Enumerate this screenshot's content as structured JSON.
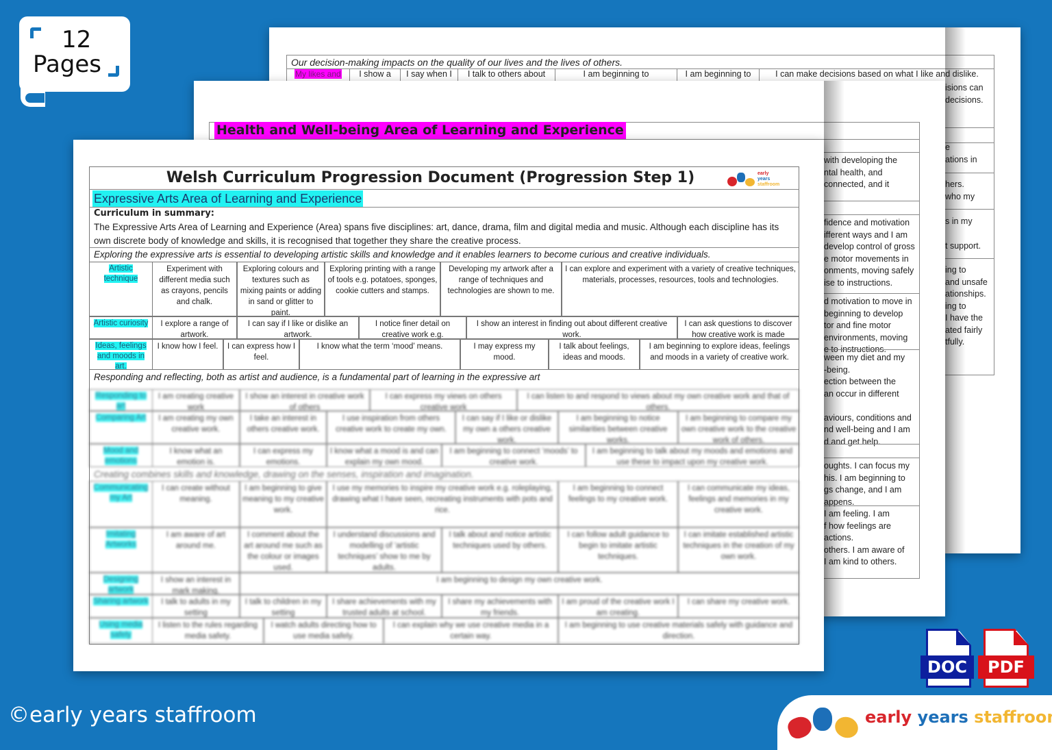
{
  "badge": {
    "count": "12",
    "label": "Pages",
    "icon": "page-scroll-icon"
  },
  "back_page": {
    "heading": "Our decision-making impacts on the quality of our lives and the lives of others.",
    "row_label": "My likes and",
    "row_cells": [
      "I show a",
      "I say when I",
      "I talk to others about",
      "I am beginning to",
      "I am beginning to",
      "I can make decisions based on what I like and dislike."
    ],
    "right_fragments": [
      "isions can",
      "decisions.",
      "e",
      "ations in",
      "hers.",
      "who my",
      "s in my",
      "t support.",
      "ing to",
      "and unsafe",
      "ationships.",
      "ing to",
      "I have the",
      "ated fairly",
      "tfully."
    ]
  },
  "middle_page": {
    "title": "Health and Well-being Area of Learning and Experience",
    "right_cells": [
      [
        "with developing the",
        "ntal health, and",
        "connected, and it"
      ],
      [
        "fidence and motivation",
        "ifferent ways and I am",
        "develop control of gross",
        "e motor movements in",
        "onments, moving safely",
        "ise to instructions."
      ],
      [
        "d motivation to move in",
        "beginning to develop",
        "tor and fine motor",
        "environments, moving",
        "e to instructions."
      ],
      [
        "ween my diet and my",
        "-being.",
        "ection between the",
        "an occur in different",
        "",
        "aviours, conditions and",
        "nd well-being and I am",
        "d and get help."
      ],
      [
        "oughts. I can focus my",
        "his. I am beginning to",
        "gs change, and I am",
        "appens."
      ],
      [
        "I am feeling. I am",
        "f how feelings are",
        "actions.",
        "others. I am aware of",
        "I am kind to others."
      ]
    ]
  },
  "front_page": {
    "title": "Welsh Curriculum Progression Document (Progression Step 1)",
    "area": "Expressive Arts Area of Learning and Experience",
    "summary_heading": "Curriculum in summary:",
    "summary": "The Expressive Arts Area of Learning and Experience (Area) spans five disciplines: art, dance, drama, film and digital media and music. Although each discipline has its own discrete body of knowledge and skills, it is recognised that together they share the creative process.",
    "statement1": "Exploring the expressive arts is essential to developing artistic skills and knowledge and it enables learners to become curious and creative individuals.",
    "rows1": [
      {
        "label": "Artistic technique",
        "cells": [
          "Experiment with different media such as crayons, pencils and chalk.",
          "Exploring colours and textures such as mixing paints or adding in sand or glitter to paint.",
          "Exploring printing with a range of tools e.g. potatoes, sponges, cookie cutters and stamps.",
          "Developing my artwork after a range of techniques and technologies are shown to me.",
          "I can explore and experiment with a variety of creative techniques, materials, processes, resources, tools and technologies."
        ]
      },
      {
        "label": "Artistic curiosity",
        "cells": [
          "I explore a range of artwork.",
          "I can say if I like or dislike an artwork.",
          "I notice finer detail on creative work e.g.",
          "I show an interest in finding out about different creative work.",
          "I can ask questions to discover how creative work is made"
        ]
      },
      {
        "label": "Ideas, feelings and moods in art.",
        "cells": [
          "I know how I feel.",
          "I can express how I feel.",
          "I know what the term ‘mood’ means.",
          "I may express my mood.",
          "I talk about feelings, ideas and moods.",
          "I am beginning to explore ideas, feelings and moods in a variety of creative work."
        ]
      }
    ],
    "statement2": "Responding and reflecting, both as artist and audience, is a fundamental part of learning in the expressive art",
    "rows2": [
      {
        "label": "Responding to art",
        "cells": [
          "I am creating creative work",
          "I show an interest in creative work of others",
          "I can express my views on others creative work",
          "I can listen to and respond to views about my own creative work and that of others."
        ]
      },
      {
        "label": "Comparing Art",
        "cells": [
          "I am creating my own creative work.",
          "I take an interest in others creative work.",
          "I use inspiration from others creative work to create my own.",
          "I can say if I like or dislike my own a others creative work.",
          "I am beginning to notice similarities between creative works.",
          "I am beginning to compare my own creative work to the creative work of others."
        ]
      },
      {
        "label": "Mood and emotions",
        "cells": [
          "I know what an emotion is.",
          "I can express my emotions.",
          "I know what a mood is and can explain my own mood.",
          "I am beginning to connect ‘moods’ to creative work.",
          "I am beginning to talk about my moods and emotions and use these to impact upon my creative work."
        ]
      }
    ],
    "statement3": "Creating combines skills and knowledge, drawing on the senses, inspiration and imagination.",
    "rows3": [
      {
        "label": "Communicating my Art",
        "cells": [
          "I can create without meaning.",
          "I am beginning to give meaning to my creative work.",
          "I use my memories to inspire my creative work e.g. roleplaying, drawing what I have seen, recreating instruments with pots and rice.",
          "I am beginning to connect feelings to my creative work.",
          "I can communicate my ideas, feelings and memories in my creative work."
        ]
      },
      {
        "label": "Imitating Artworks",
        "cells": [
          "I am aware of art around me.",
          "I comment about the art around me such as the colour or images used.",
          "I understand discussions and modelling of ‘artistic techniques’ show to me by adults.",
          "I talk about and notice artistic techniques used by others.",
          "I can follow adult guidance to begin to imitate artistic techniques.",
          "I can imitate established artistic techniques in the creation of my own work."
        ]
      },
      {
        "label": "Designing artwork",
        "cells": [
          "I show an interest in mark making.",
          "I am beginning to design my own creative work."
        ]
      },
      {
        "label": "Sharing artwork",
        "cells": [
          "I talk to adults in my setting",
          "I talk to children in my setting",
          "I share achievements with my trusted adults at school.",
          "I share my achievements with my friends.",
          "I am proud of the creative work I am creating.",
          "I can share my creative work."
        ]
      },
      {
        "label": "Using media safely",
        "cells": [
          "I listen to the rules regarding media safety.",
          "I watch adults directing how to use media safely.",
          "I can explain why we use creative media in a certain way.",
          "I am beginning to use creative materials safely with guidance and direction."
        ]
      }
    ],
    "logo_text": [
      "early",
      "years",
      "staffroom"
    ]
  },
  "formats": [
    {
      "label": "DOC",
      "color": "#0d1f9e"
    },
    {
      "label": "PDF",
      "color": "#d8121a"
    }
  ],
  "footer": {
    "copyright": "©early years staffroom",
    "brand": [
      "early",
      "years",
      "staffroom"
    ],
    "brand_colors": [
      "#d8252b",
      "#1d6fb8",
      "#f2b632"
    ]
  },
  "colors": {
    "background": "#1576bd",
    "cyan_highlight": "#22f2f2",
    "magenta_highlight": "#ff00ff"
  }
}
